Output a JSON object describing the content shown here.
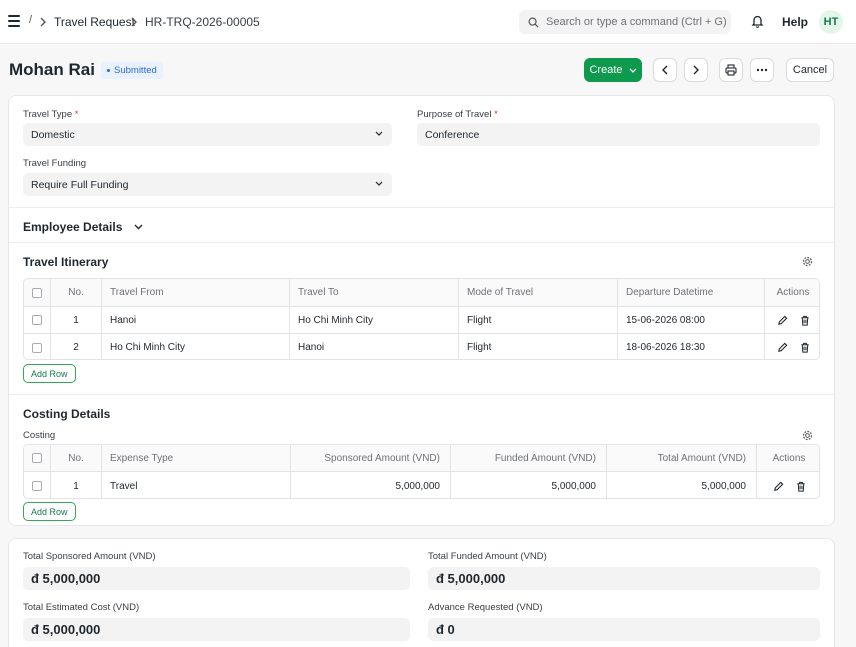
{
  "navbar": {
    "breadcrumb_sep": "/",
    "breadcrumbs": [
      "Travel Request",
      "HR-TRQ-2026-00005"
    ],
    "search_placeholder": "Search or type a command (Ctrl + G)",
    "help_label": "Help",
    "avatar_initials": "HT"
  },
  "header": {
    "title": "Mohan Rai",
    "status": "Submitted",
    "create_label": "Create",
    "cancel_label": "Cancel"
  },
  "form": {
    "travel_type_label": "Travel Type",
    "travel_type_value": "Domestic",
    "purpose_label": "Purpose of Travel",
    "purpose_value": "Conference",
    "funding_label": "Travel Funding",
    "funding_value": "Require Full Funding",
    "required_mark": "*"
  },
  "employee_details": {
    "title": "Employee Details"
  },
  "itinerary": {
    "title": "Travel Itinerary",
    "columns": [
      "No.",
      "Travel From",
      "Travel To",
      "Mode of Travel",
      "Departure Datetime",
      "Actions"
    ],
    "rows": [
      {
        "no": "1",
        "from": "Hanoi",
        "to": "Ho Chi Minh City",
        "mode": "Flight",
        "departure": "15-06-2026 08:00"
      },
      {
        "no": "2",
        "from": "Ho Chi Minh City",
        "to": "Hanoi",
        "mode": "Flight",
        "departure": "18-06-2026 18:30"
      }
    ],
    "add_row_label": "Add Row"
  },
  "costing": {
    "title": "Costing Details",
    "subtitle": "Costing",
    "columns": [
      "No.",
      "Expense Type",
      "Sponsored Amount (VND)",
      "Funded Amount (VND)",
      "Total Amount (VND)",
      "Actions"
    ],
    "rows": [
      {
        "no": "1",
        "expense": "Travel",
        "sponsored": "5,000,000",
        "funded": "5,000,000",
        "total": "5,000,000"
      }
    ],
    "add_row_label": "Add Row"
  },
  "totals": {
    "sponsored_label": "Total Sponsored Amount (VND)",
    "sponsored_value": "đ 5,000,000",
    "funded_label": "Total Funded Amount (VND)",
    "funded_value": "đ 5,000,000",
    "estimated_label": "Total Estimated Cost (VND)",
    "estimated_value": "đ 5,000,000",
    "advance_label": "Advance Requested (VND)",
    "advance_value": "đ 0"
  },
  "colors": {
    "primary": "#0d9a4c",
    "status_bg": "#e8f1fd",
    "status_text": "#2d6ad8",
    "required": "#e03636"
  },
  "icons": [
    "menu-icon",
    "chevron-right-icon",
    "search-icon",
    "bell-icon",
    "chevron-down-icon",
    "chevron-left-icon",
    "printer-icon",
    "more-icon",
    "gear-icon",
    "edit-icon",
    "trash-icon"
  ]
}
